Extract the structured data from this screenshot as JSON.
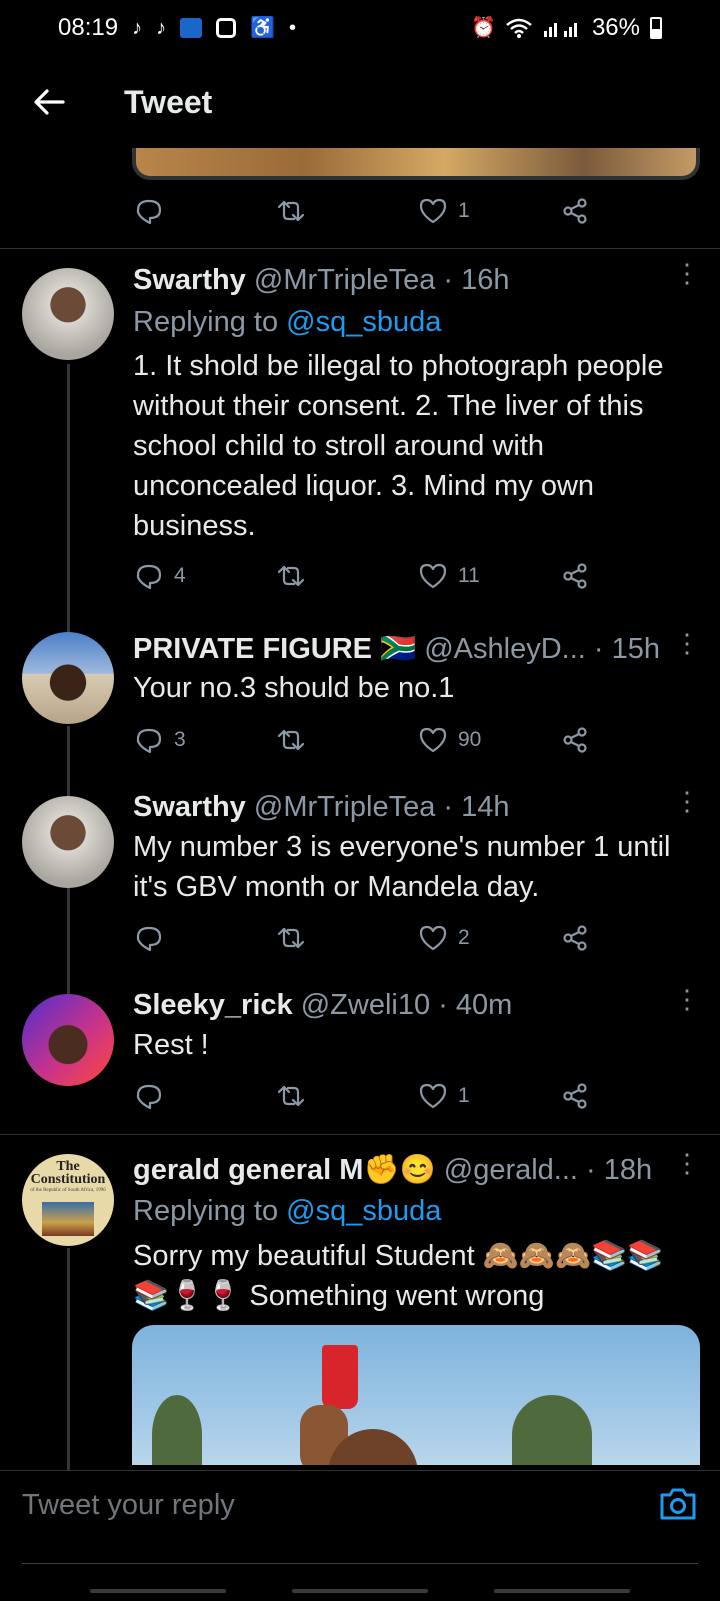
{
  "status_bar": {
    "time": "08:19",
    "battery": "36%",
    "icons": [
      "tiktok-icon",
      "tiktok-icon",
      "mnet-icon",
      "app-icon",
      "accessibility-icon",
      "dot-icon",
      "alarm-icon",
      "wifi-icon",
      "signal-icon",
      "battery-icon"
    ]
  },
  "header": {
    "title": "Tweet"
  },
  "top_tweet_actions": {
    "likes": "1"
  },
  "tweets": [
    {
      "name": "Swarthy",
      "meta": "@MrTripleTea · 16h",
      "replying_prefix": "Replying to",
      "replying_to": "@sq_sbuda",
      "text": "1. It shold be illegal to photograph people without their consent. 2. The liver of this school child to stroll around with unconcealed liquor. 3. Mind my own business.",
      "replies": "4",
      "retweets": "",
      "likes": "11"
    },
    {
      "name": "PRIVATE FIGURE 🇿🇦",
      "meta": "@AshleyD... · 15h",
      "text": "Your no.3 should be no.1",
      "replies": "3",
      "retweets": "",
      "likes": "90"
    },
    {
      "name": "Swarthy",
      "meta": "@MrTripleTea · 14h",
      "text": "My number 3 is everyone's number 1 until it's GBV month or Mandela day.",
      "replies": "",
      "retweets": "",
      "likes": "2"
    },
    {
      "name": "Sleeky_rick",
      "meta": "@Zweli10 · 40m",
      "text": "Rest !",
      "replies": "",
      "retweets": "",
      "likes": "1"
    },
    {
      "name": "gerald general M✊😊",
      "meta": "@gerald... · 18h",
      "replying_prefix": "Replying to",
      "replying_to": "@sq_sbuda",
      "text": "Sorry my beautiful Student 🙈🙈🙈📚📚📚🍷🍷 Something went wrong"
    }
  ],
  "avatar_text": {
    "line1": "The Constitution",
    "line2": "of the Republic of South Africa, 1996"
  },
  "reply_bar": {
    "placeholder": "Tweet your reply"
  },
  "colors": {
    "background": "#000000",
    "text": "#e7e9ea",
    "muted": "#8b98a5",
    "accent": "#1d9bf0",
    "divider": "#2f3336"
  }
}
